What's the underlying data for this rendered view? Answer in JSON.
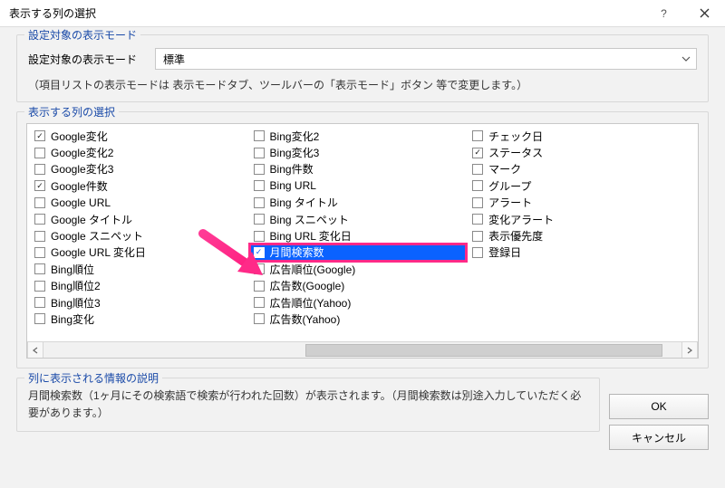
{
  "title": "表示する列の選択",
  "group_mode": {
    "legend": "設定対象の表示モード",
    "label": "設定対象の表示モード",
    "combo_value": "標準",
    "note": "（項目リストの表示モードは 表示モードタブ、ツールバーの「表示モード」ボタン 等で変更します。）"
  },
  "group_cols": {
    "legend": "表示する列の選択"
  },
  "columns": [
    [
      {
        "label": "Google変化",
        "checked": true
      },
      {
        "label": "Google変化2",
        "checked": false
      },
      {
        "label": "Google変化3",
        "checked": false
      },
      {
        "label": "Google件数",
        "checked": true
      },
      {
        "label": "Google URL",
        "checked": false
      },
      {
        "label": "Google タイトル",
        "checked": false
      },
      {
        "label": "Google スニペット",
        "checked": false
      },
      {
        "label": "Google URL 変化日",
        "checked": false
      },
      {
        "label": "Bing順位",
        "checked": false
      },
      {
        "label": "Bing順位2",
        "checked": false
      },
      {
        "label": "Bing順位3",
        "checked": false
      },
      {
        "label": "Bing変化",
        "checked": false
      }
    ],
    [
      {
        "label": "Bing変化2",
        "checked": false
      },
      {
        "label": "Bing変化3",
        "checked": false
      },
      {
        "label": "Bing件数",
        "checked": false
      },
      {
        "label": "Bing URL",
        "checked": false
      },
      {
        "label": "Bing タイトル",
        "checked": false
      },
      {
        "label": "Bing スニペット",
        "checked": false
      },
      {
        "label": "Bing URL 変化日",
        "checked": false
      },
      {
        "label": "月間検索数",
        "checked": true,
        "highlight": true
      },
      {
        "label": "広告順位(Google)",
        "checked": false
      },
      {
        "label": "広告数(Google)",
        "checked": false
      },
      {
        "label": "広告順位(Yahoo)",
        "checked": false
      },
      {
        "label": "広告数(Yahoo)",
        "checked": false
      }
    ],
    [
      {
        "label": "チェック日",
        "checked": false
      },
      {
        "label": "ステータス",
        "checked": true
      },
      {
        "label": "マーク",
        "checked": false
      },
      {
        "label": "グループ",
        "checked": false
      },
      {
        "label": "アラート",
        "checked": false
      },
      {
        "label": "変化アラート",
        "checked": false
      },
      {
        "label": "表示優先度",
        "checked": false
      },
      {
        "label": "登録日",
        "checked": false
      }
    ]
  ],
  "group_desc": {
    "legend": "列に表示される情報の説明",
    "text": "月間検索数（1ヶ月にその検索語で検索が行われた回数）が表示されます。（月間検索数は別途入力していただく必要があります。）"
  },
  "buttons": {
    "ok": "OK",
    "cancel": "キャンセル"
  }
}
